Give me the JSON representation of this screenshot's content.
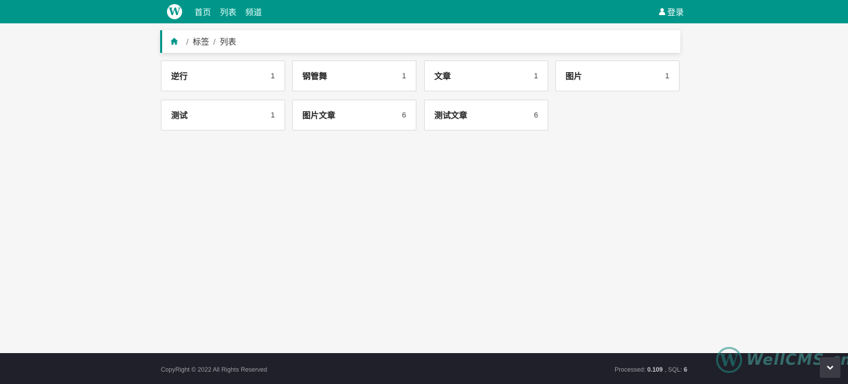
{
  "nav": {
    "logo_letter": "W",
    "links": [
      "首页",
      "列表",
      "频道"
    ],
    "login_label": "登录"
  },
  "breadcrumb": {
    "home_icon": "home-icon",
    "items": [
      "标签",
      "列表"
    ],
    "separator": "/"
  },
  "tags": [
    {
      "name": "逆行",
      "count": "1"
    },
    {
      "name": "钢管舞",
      "count": "1"
    },
    {
      "name": "文章",
      "count": "1"
    },
    {
      "name": "图片",
      "count": "1"
    },
    {
      "name": "测试",
      "count": "1"
    },
    {
      "name": "图片文章",
      "count": "6"
    },
    {
      "name": "测试文章",
      "count": "6"
    }
  ],
  "footer": {
    "copyright": "CopyRight © 2022 All Rights Reserved",
    "processed_label": "Processed:",
    "processed_value": "0.109",
    "sql_label": ", SQL:",
    "sql_value": "6"
  },
  "watermark": {
    "logo_letter": "W",
    "text": "WellCMS.cn"
  },
  "colors": {
    "brand": "#00978a",
    "footer_bg": "#1f2029",
    "page_bg": "#f6f6f6"
  }
}
